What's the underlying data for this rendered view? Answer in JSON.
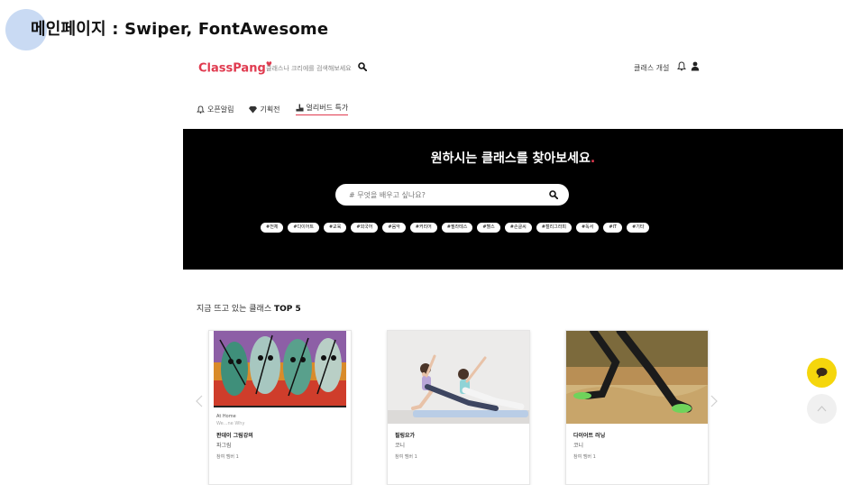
{
  "slide": {
    "title": "메인페이지 : Swiper, FontAwesome"
  },
  "header": {
    "logo": "ClassPang",
    "search_placeholder": "클래스나 크리에를 검색해보세요",
    "open_class": "클래스 개설"
  },
  "nav": {
    "items": [
      {
        "label": "오픈알림",
        "icon": "bell-icon"
      },
      {
        "label": "기획전",
        "icon": "gem-icon"
      },
      {
        "label": "얼리버드 특가",
        "icon": "hand-icon",
        "active": true
      }
    ]
  },
  "hero": {
    "title": "원하시는 클래스를 찾아보세요",
    "title_dot": ".",
    "search_placeholder": "# 무엇을 배우고 싶나요?",
    "tags": [
      "#전체",
      "#다이어트",
      "#교육",
      "#외국어",
      "#음악",
      "#커리어",
      "#필라테스",
      "#헬스",
      "#손글씨",
      "#캘리그라피",
      "#독서",
      "#IT",
      "#기타"
    ]
  },
  "top5": {
    "title_prefix": "지금 뜨고 있는 클래스 ",
    "title_bold": "TOP 5",
    "cards": [
      {
        "caption": "At Home",
        "caption2": "We...ne Why",
        "name": "판데이 그림강의",
        "author": "파그림",
        "meta": "참여 멤버 1"
      },
      {
        "name": "필링요가",
        "author": "코니",
        "meta": "참여 멤버 1"
      },
      {
        "name": "다이어트 러닝",
        "author": "코니",
        "meta": "참여 멤버 1"
      }
    ]
  },
  "colors": {
    "brand": "#e03a4f",
    "hero_bg": "#000000",
    "chat_button": "#f5d60c"
  }
}
